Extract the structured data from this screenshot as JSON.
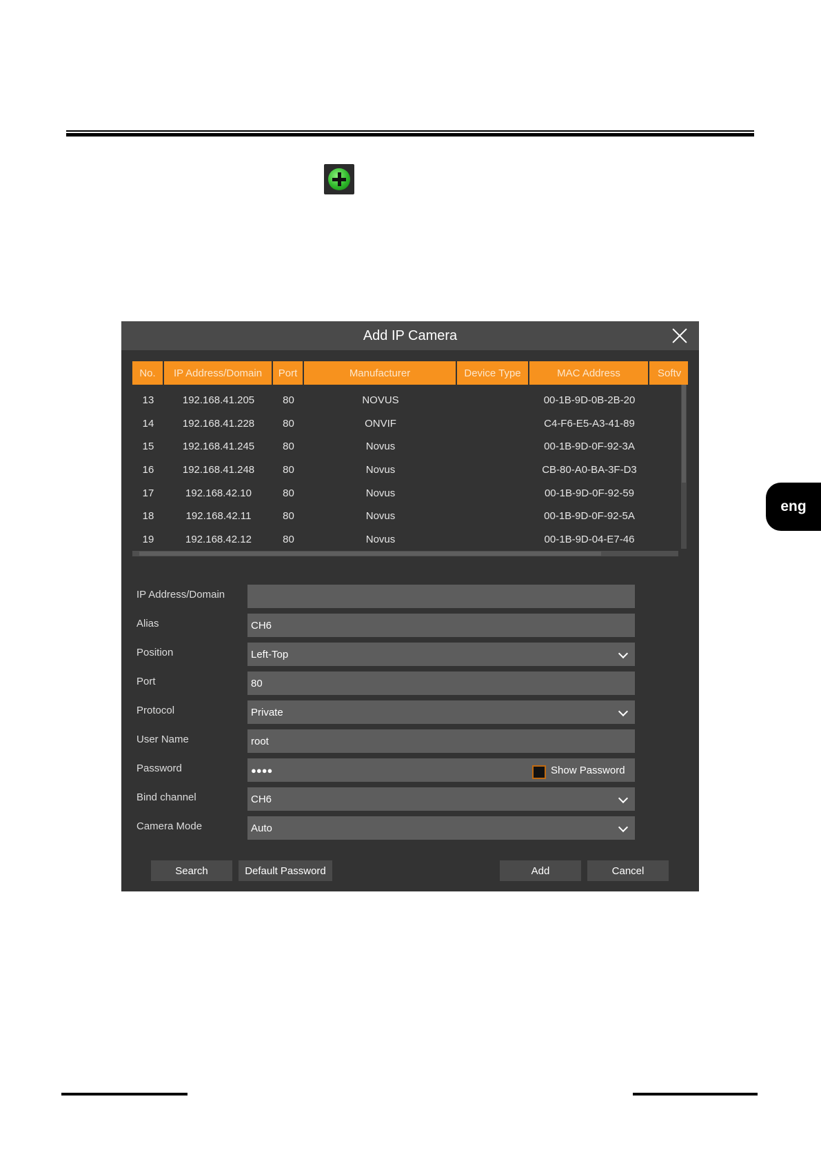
{
  "dialog": {
    "title": "Add IP Camera",
    "table": {
      "headers": [
        "No.",
        "IP Address/Domain",
        "Port",
        "Manufacturer",
        "Device Type",
        "MAC Address",
        "Softv"
      ],
      "rows": [
        [
          "13",
          "192.168.41.205",
          "80",
          "NOVUS",
          "",
          "00-1B-9D-0B-2B-20"
        ],
        [
          "14",
          "192.168.41.228",
          "80",
          "ONVIF",
          "",
          "C4-F6-E5-A3-41-89"
        ],
        [
          "15",
          "192.168.41.245",
          "80",
          "Novus",
          "",
          "00-1B-9D-0F-92-3A"
        ],
        [
          "16",
          "192.168.41.248",
          "80",
          "Novus",
          "",
          "CB-80-A0-BA-3F-D3"
        ],
        [
          "17",
          "192.168.42.10",
          "80",
          "Novus",
          "",
          "00-1B-9D-0F-92-59"
        ],
        [
          "18",
          "192.168.42.11",
          "80",
          "Novus",
          "",
          "00-1B-9D-0F-92-5A"
        ],
        [
          "19",
          "192.168.42.12",
          "80",
          "Novus",
          "",
          "00-1B-9D-04-E7-46"
        ]
      ]
    },
    "form": {
      "ip_label": "IP Address/Domain",
      "ip_value": "",
      "alias_label": "Alias",
      "alias_value": "CH6",
      "position_label": "Position",
      "position_value": "Left-Top",
      "port_label": "Port",
      "port_value": "80",
      "protocol_label": "Protocol",
      "protocol_value": "Private",
      "username_label": "User Name",
      "username_value": "root",
      "password_label": "Password",
      "password_value": "●●●●",
      "show_password_label": "Show Password",
      "bind_label": "Bind channel",
      "bind_value": "CH6",
      "mode_label": "Camera Mode",
      "mode_value": "Auto"
    },
    "buttons": {
      "search": "Search",
      "default_password": "Default Password",
      "add": "Add",
      "cancel": "Cancel"
    }
  },
  "side_tab": "eng",
  "colors": {
    "header_orange": "#f7921e",
    "dialog_bg": "#333333",
    "field_bg": "#5d5d5d"
  }
}
